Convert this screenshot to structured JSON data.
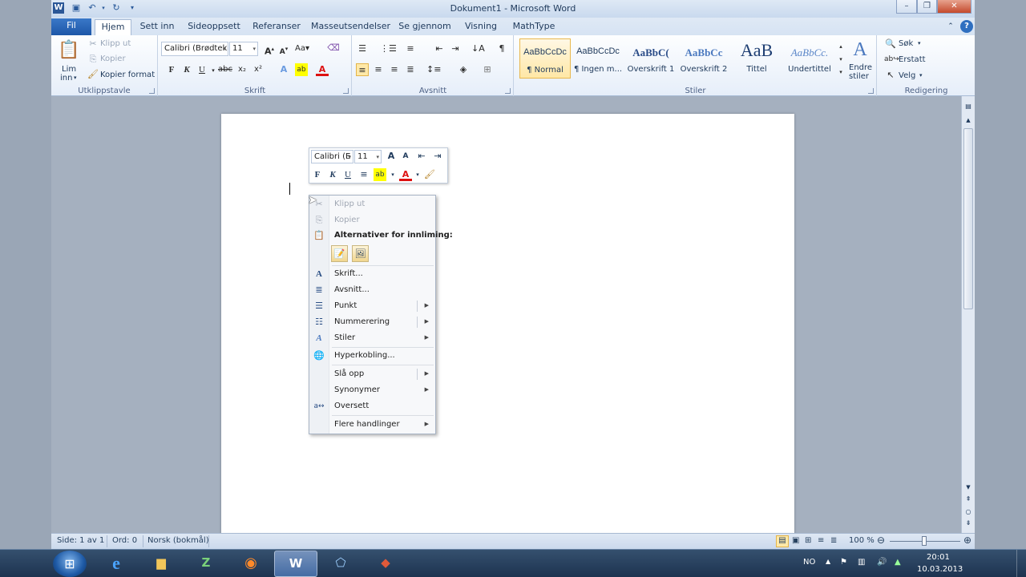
{
  "window": {
    "title": "Dokument1 - Microsoft Word",
    "app_icon": "W",
    "buttons": {
      "minimize": "–",
      "restore": "❐",
      "close": "✕"
    }
  },
  "tabs": [
    {
      "label": "Fil"
    },
    {
      "label": "Hjem"
    },
    {
      "label": "Sett inn"
    },
    {
      "label": "Sideoppsett"
    },
    {
      "label": "Referanser"
    },
    {
      "label": "Masseutsendelser"
    },
    {
      "label": "Se gjennom"
    },
    {
      "label": "Visning"
    },
    {
      "label": "MathType"
    }
  ],
  "ribbon": {
    "clipboard": {
      "paste_label": "Lim",
      "paste_label2": "inn",
      "cut": "Klipp ut",
      "copy": "Kopier",
      "format_painter": "Kopier format",
      "group": "Utklippstavle"
    },
    "font": {
      "font_name": "Calibri (Brødtek",
      "font_size": "11",
      "bold": "F",
      "italic": "K",
      "underline": "U",
      "group": "Skrift"
    },
    "paragraph": {
      "group": "Avsnitt"
    },
    "styles": {
      "items": [
        {
          "sample": "AaBbCcDc",
          "name": "¶ Normal"
        },
        {
          "sample": "AaBbCcDc",
          "name": "¶ Ingen m..."
        },
        {
          "sample": "AaBbC(",
          "name": "Overskrift 1"
        },
        {
          "sample": "AaBbCc",
          "name": "Overskrift 2"
        },
        {
          "sample": "AaB",
          "name": "Tittel"
        },
        {
          "sample": "AaBbCc.",
          "name": "Undertittel"
        }
      ],
      "change_styles": "Endre",
      "change_styles2": "stiler",
      "group": "Stiler"
    },
    "editing": {
      "find": "Søk",
      "replace": "Erstatt",
      "select": "Velg",
      "group": "Redigering"
    }
  },
  "mini_toolbar": {
    "font": "Calibri (E",
    "size": "11",
    "bold": "F",
    "italic": "K",
    "underline": "U"
  },
  "context_menu": {
    "cut": "Klipp ut",
    "copy": "Kopier",
    "paste_options": "Alternativer for innliming:",
    "font": "Skrift...",
    "paragraph": "Avsnitt...",
    "bullets": "Punkt",
    "numbering": "Nummerering",
    "styles": "Stiler",
    "hyperlink": "Hyperkobling...",
    "lookup": "Slå opp",
    "synonyms": "Synonymer",
    "translate": "Oversett",
    "more_actions": "Flere handlinger"
  },
  "status_bar": {
    "page": "Side: 1 av 1",
    "words": "Ord: 0",
    "language": "Norsk (bokmål)",
    "zoom": "100 %"
  },
  "taskbar": {
    "lang": "NO",
    "time": "20:01",
    "date": "10.03.2013"
  }
}
